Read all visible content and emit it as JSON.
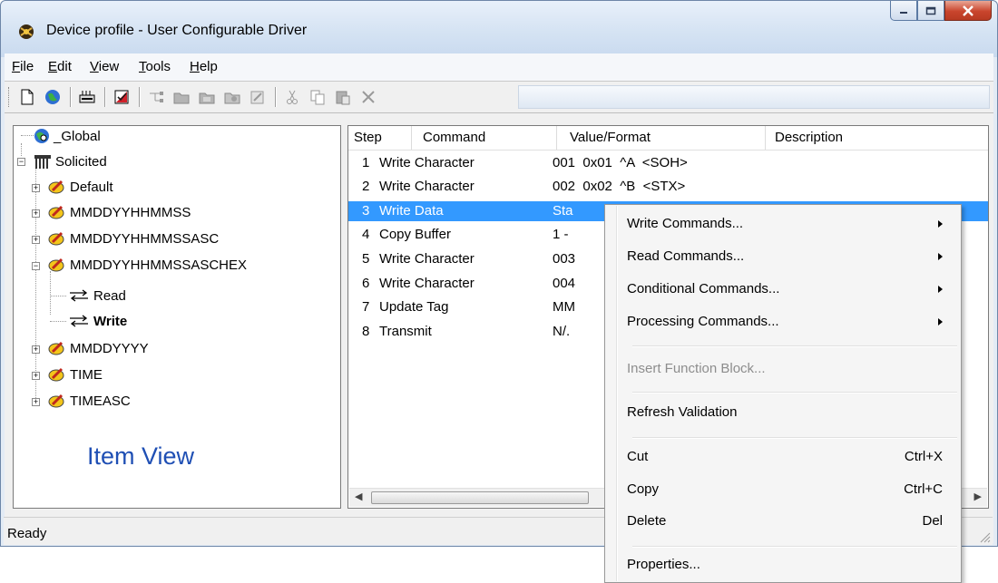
{
  "window": {
    "title": "Device profile - User Configurable Driver"
  },
  "menubar": {
    "items": [
      {
        "u": "F",
        "rest": "ile"
      },
      {
        "u": "E",
        "rest": "dit"
      },
      {
        "u": "V",
        "rest": "iew"
      },
      {
        "u": "T",
        "rest": "ools"
      },
      {
        "u": "H",
        "rest": "elp"
      }
    ]
  },
  "tree": {
    "items": [
      {
        "label": "_Global",
        "icon": "global-icon"
      },
      {
        "label": "Solicited",
        "icon": "solicited-icon"
      },
      {
        "label": "Default",
        "icon": "transaction-icon"
      },
      {
        "label": "MMDDYYHHMMSS",
        "icon": "transaction-icon"
      },
      {
        "label": "MMDDYYHHMMSSASC",
        "icon": "transaction-icon"
      },
      {
        "label": "MMDDYYHHMMSSASCHEX",
        "icon": "transaction-icon"
      },
      {
        "label": "Read",
        "icon": "read-write-arrows-icon"
      },
      {
        "label": "Write",
        "icon": "read-write-arrows-icon"
      },
      {
        "label": "MMDDYYYY",
        "icon": "transaction-icon"
      },
      {
        "label": "TIME",
        "icon": "transaction-icon"
      },
      {
        "label": "TIMEASC",
        "icon": "transaction-icon"
      }
    ],
    "caption": "Item View"
  },
  "list": {
    "columns": [
      "Step",
      "Command",
      "Value/Format",
      "Description"
    ],
    "rows": [
      {
        "step": "1",
        "command": "Write Character",
        "value": "001  0x01  ^A  <SOH>"
      },
      {
        "step": "2",
        "command": "Write Character",
        "value": "002  0x02  ^B  <STX>"
      },
      {
        "step": "3",
        "command": "Write Data",
        "value": "Sta"
      },
      {
        "step": "4",
        "command": "Copy Buffer",
        "value": "1 -"
      },
      {
        "step": "5",
        "command": "Write Character",
        "value": "003"
      },
      {
        "step": "6",
        "command": "Write Character",
        "value": "004"
      },
      {
        "step": "7",
        "command": "Update Tag",
        "value": "MM"
      },
      {
        "step": "8",
        "command": "Transmit",
        "value": "N/."
      }
    ],
    "selected_step": "3"
  },
  "context_menu": {
    "items": [
      {
        "label": "Write Commands...",
        "submenu": true
      },
      {
        "label": "Read Commands...",
        "submenu": true
      },
      {
        "label": "Conditional Commands...",
        "submenu": true
      },
      {
        "label": "Processing Commands...",
        "submenu": true
      },
      {
        "label": "Insert Function Block...",
        "disabled": true
      },
      {
        "label": "Refresh Validation"
      },
      {
        "label": "Cut",
        "shortcut": "Ctrl+X"
      },
      {
        "label": "Copy",
        "shortcut": "Ctrl+C"
      },
      {
        "label": "Delete",
        "shortcut": "Del"
      },
      {
        "label": "Properties..."
      }
    ]
  },
  "status": {
    "text": "Ready"
  },
  "colors": {
    "selection": "#3399ff",
    "caption": "#1f4fb4",
    "close_button": "#c9452d"
  }
}
